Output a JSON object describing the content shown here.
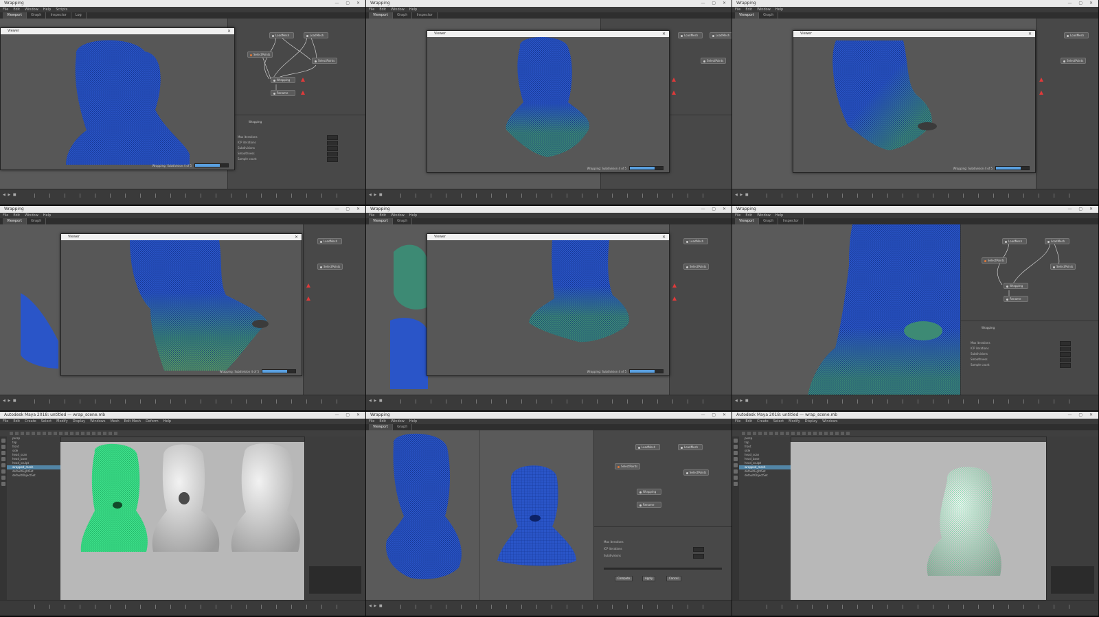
{
  "colors": {
    "mesh_blue": "#2a55c8",
    "mesh_green": "#3d8a74",
    "wire_green": "#3ee08a",
    "sculpt_grey": "#d8d8d8",
    "viewport_bg": "#5a5a5a",
    "progress_fill": "#5aa0e0",
    "warning_red": "#e03a3a",
    "selection_blue": "#5285a6"
  },
  "menus": {
    "main": [
      "File",
      "Edit",
      "Window",
      "Help",
      "Scripts"
    ],
    "tabs": [
      "Viewport",
      "Graph",
      "Inspector",
      "Log"
    ]
  },
  "node_graph": {
    "nodes": [
      "LoadMesh",
      "LoadMesh",
      "SelectPoints",
      "SelectPoints",
      "Wrapping",
      "Rename"
    ],
    "inspector_title": "Wrapping",
    "attributes": [
      "Max iterations",
      "ICP iterations",
      "Subdivisions",
      "Smoothness",
      "Sample count"
    ]
  },
  "dialogs": {
    "viewer_title": "Viewer",
    "status_text": "Wrapping: Subdivision 4 of 5",
    "progress_percent": 75
  },
  "maya": {
    "title": "Autodesk Maya 2018: untitled — wrap_scene.mb",
    "menu": [
      "File",
      "Edit",
      "Create",
      "Select",
      "Modify",
      "Display",
      "Windows",
      "Mesh",
      "Edit Mesh",
      "Deform",
      "Help"
    ],
    "outliner": [
      "persp",
      "top",
      "front",
      "side",
      "head_scan",
      "head_base",
      "head_sculpt",
      "wrapped_mesh",
      "defaultLightSet",
      "defaultObjectSet"
    ]
  },
  "export_dialog": {
    "buttons": [
      "Compute",
      "Apply",
      "Cancel"
    ]
  }
}
